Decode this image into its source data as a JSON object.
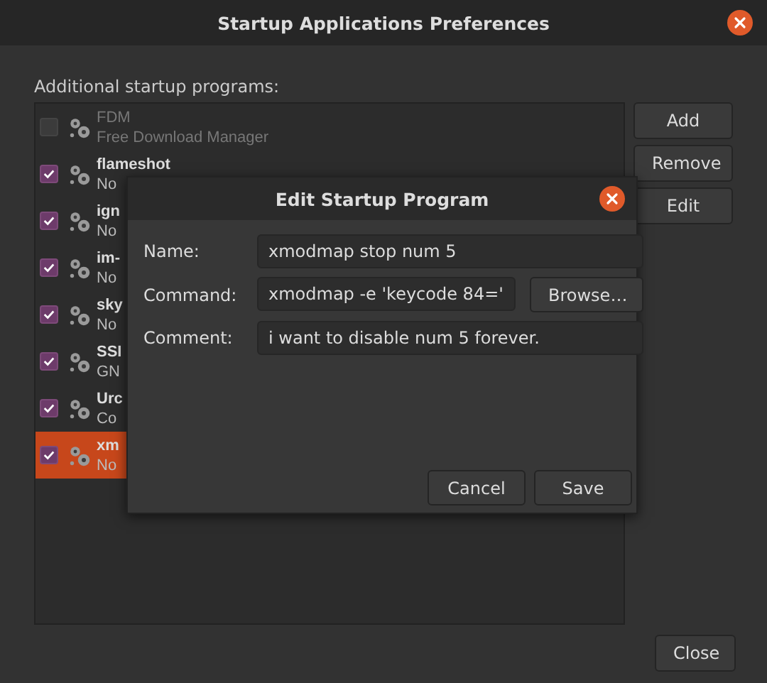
{
  "window": {
    "title": "Startup Applications Preferences"
  },
  "list_label": "Additional startup programs:",
  "programs": [
    {
      "name": "FDM",
      "comment": "Free Download Manager",
      "checked": false,
      "selected": false
    },
    {
      "name": "flameshot",
      "comment": "No",
      "checked": true,
      "selected": false
    },
    {
      "name": "ign",
      "comment": "No",
      "checked": true,
      "selected": false
    },
    {
      "name": "im-",
      "comment": "No",
      "checked": true,
      "selected": false
    },
    {
      "name": "sky",
      "comment": "No",
      "checked": true,
      "selected": false
    },
    {
      "name": "SSI",
      "comment": "GN",
      "checked": true,
      "selected": false
    },
    {
      "name": "Urc",
      "comment": "Co",
      "checked": true,
      "selected": false
    },
    {
      "name": "xm",
      "comment": "No",
      "checked": true,
      "selected": true
    }
  ],
  "side_buttons": [
    "Add",
    "Remove",
    "Edit"
  ],
  "close_button": "Close",
  "dialog": {
    "title": "Edit Startup Program",
    "name": {
      "label": "Name:",
      "value": "xmodmap stop num 5"
    },
    "command": {
      "label": "Command:",
      "value": "xmodmap -e 'keycode 84='",
      "browse": "Browse…"
    },
    "comment": {
      "label": "Comment:",
      "value": "i want to disable num 5 forever."
    },
    "buttons": [
      "Cancel",
      "Save"
    ]
  }
}
